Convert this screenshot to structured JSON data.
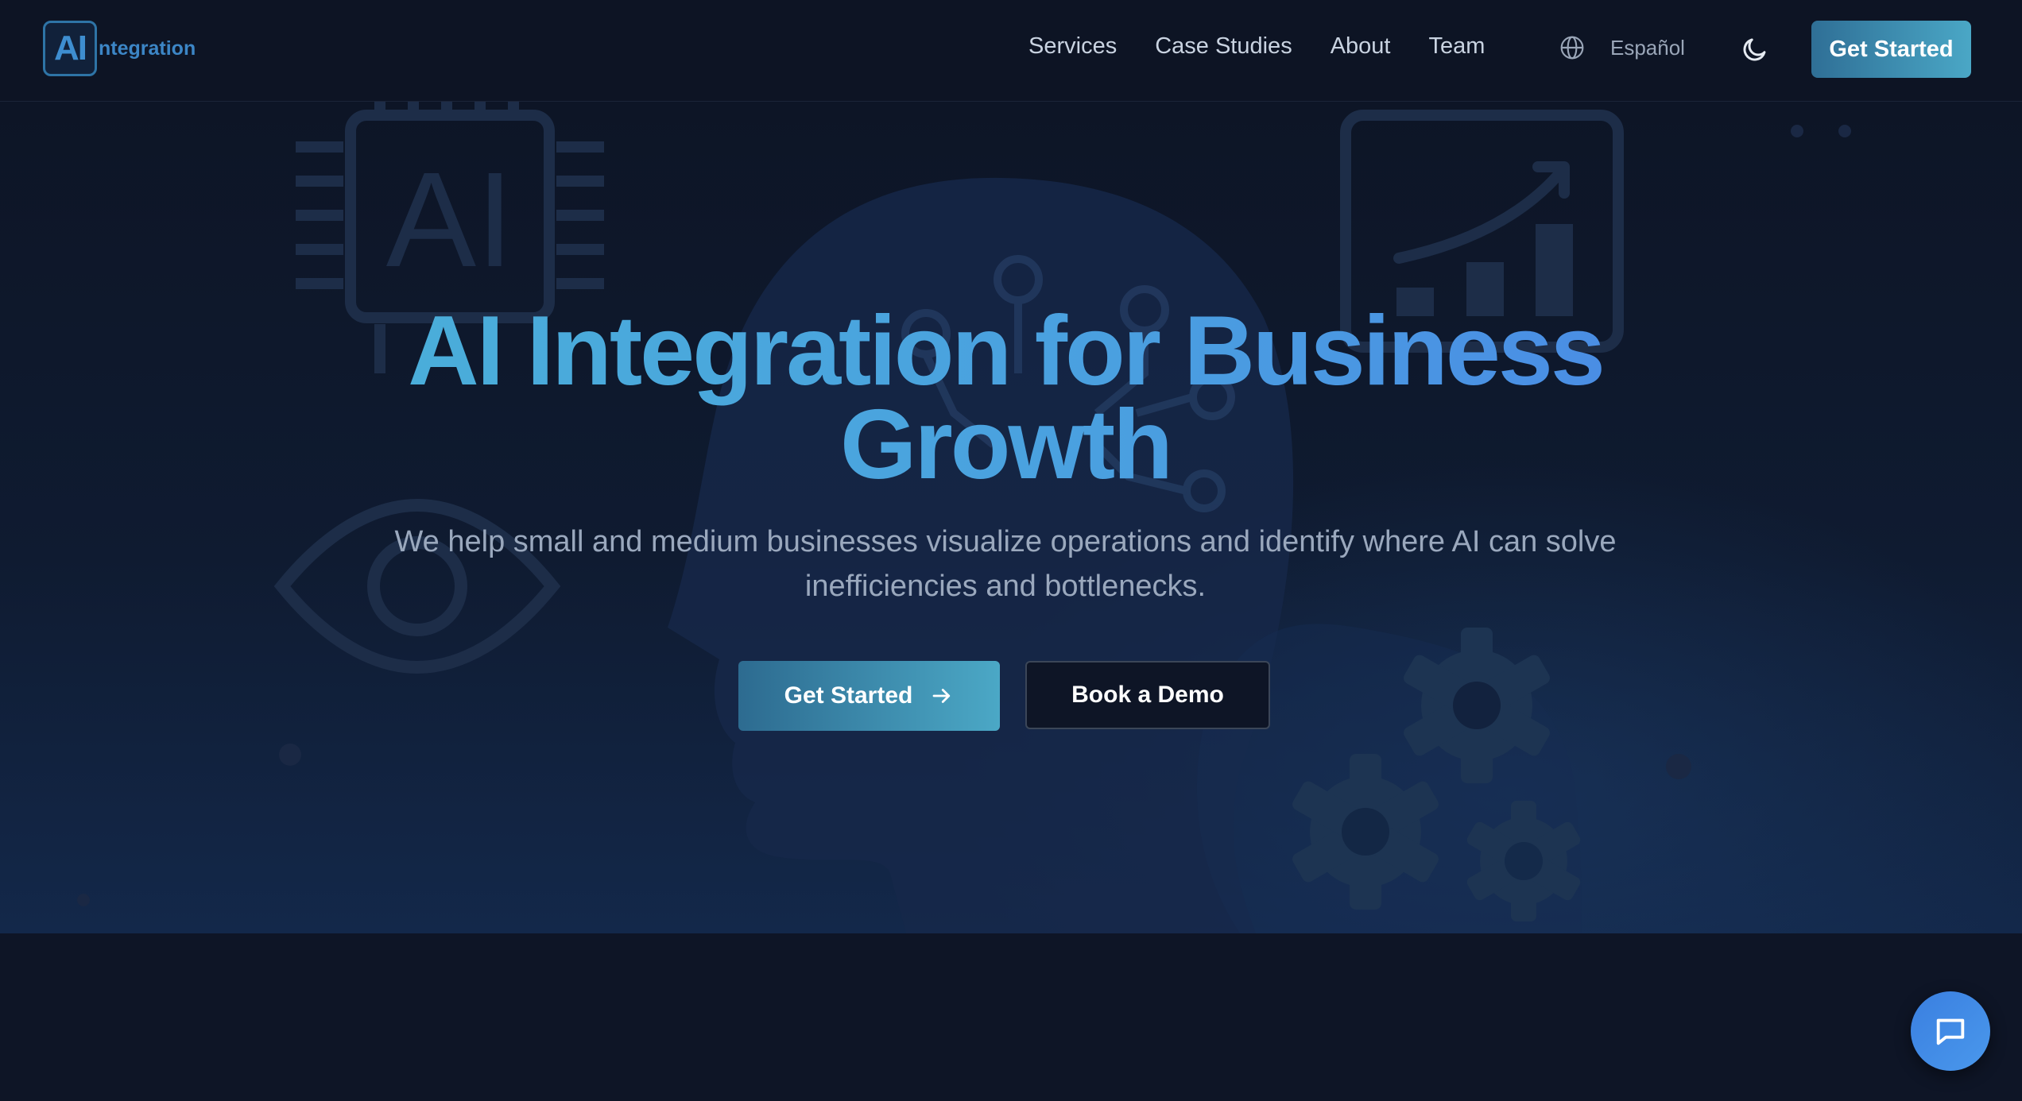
{
  "nav": {
    "logo": {
      "mark": "AI",
      "text": "ntegration"
    },
    "links": [
      "Services",
      "Case Studies",
      "About",
      "Team"
    ],
    "language": {
      "icon": "globe-icon",
      "label": "Español"
    },
    "theme_toggle_icon": "moon-icon",
    "cta_label": "Get Started"
  },
  "hero": {
    "title_line1": "AI Integration for Business",
    "title_line2": "Growth",
    "subtitle": "We help small and medium businesses visualize operations and identify where AI can solve inefficiencies and bottlenecks.",
    "primary_button": {
      "label": "Get Started",
      "icon": "arrow-right-icon"
    },
    "secondary_button": {
      "label": "Book a Demo"
    },
    "background_art": {
      "icons": [
        "ai-chip-icon",
        "chart-growth-icon",
        "eye-icon",
        "gears-icon",
        "head-silhouette",
        "circuit-lines"
      ],
      "chip_text": "AI"
    }
  },
  "chat_widget": {
    "icon": "chat-bubble-icon"
  },
  "colors": {
    "background": "#0e1526",
    "accent_gradient_start": "#4ab5d6",
    "accent_gradient_end": "#4a7fe8",
    "button_teal": "#3b8fb4",
    "chat_blue": "#3a86e6"
  }
}
